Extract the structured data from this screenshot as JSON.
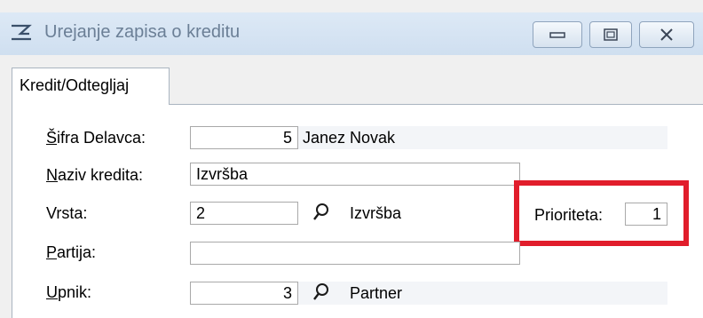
{
  "window": {
    "title": "Urejanje zapisa o kreditu",
    "icon": "sigma-icon",
    "controls": {
      "minimize": "minimize-icon",
      "maximize": "maximize-icon",
      "close": "close-icon"
    }
  },
  "tabs": [
    {
      "label": "Kredit/Odtegljaj"
    }
  ],
  "form": {
    "sifra_delavca": {
      "label_mnemonic": "Š",
      "label_rest": "ifra Delavca:",
      "value": "5",
      "name": "Janez Novak"
    },
    "naziv_kredita": {
      "label_mnemonic": "N",
      "label_rest": "aziv kredita:",
      "value": "Izvršba"
    },
    "vrsta": {
      "label": "Vrsta:",
      "value": "2",
      "name": "Izvršba",
      "lookup_icon": "search-icon"
    },
    "prioriteta": {
      "label": "Prioriteta:",
      "value": "1"
    },
    "partija": {
      "label_mnemonic": "P",
      "label_rest": "artija:",
      "value": ""
    },
    "upnik": {
      "label_mnemonic": "U",
      "label_rest": "pnik:",
      "value": "3",
      "name": "Partner",
      "lookup_icon": "search-icon"
    }
  },
  "colors": {
    "highlight": "#e11d2b",
    "title_text": "#6b7f96"
  }
}
